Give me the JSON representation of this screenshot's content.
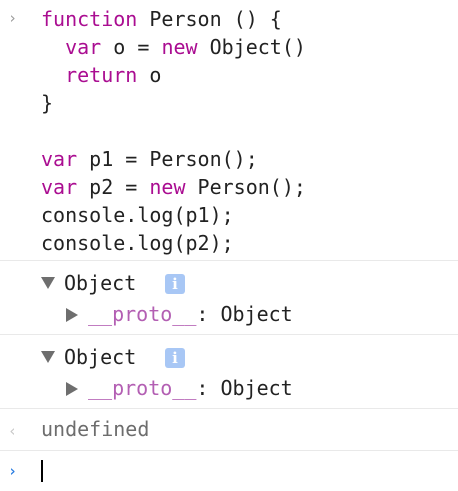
{
  "input": {
    "prompt": "›",
    "lines": [
      [
        {
          "t": "function",
          "k": true
        },
        {
          "t": " Person () {",
          "k": false
        }
      ],
      [
        {
          "t": "  ",
          "k": false
        },
        {
          "t": "var",
          "k": true
        },
        {
          "t": " o = ",
          "k": false
        },
        {
          "t": "new",
          "k": true
        },
        {
          "t": " Object()",
          "k": false
        }
      ],
      [
        {
          "t": "  ",
          "k": false
        },
        {
          "t": "return",
          "k": true
        },
        {
          "t": " o",
          "k": false
        }
      ],
      [
        {
          "t": "}",
          "k": false
        }
      ],
      [
        {
          "t": "",
          "k": false
        }
      ],
      [
        {
          "t": "var",
          "k": true
        },
        {
          "t": " p1 = Person();",
          "k": false
        }
      ],
      [
        {
          "t": "var",
          "k": true
        },
        {
          "t": " p2 = ",
          "k": false
        },
        {
          "t": "new",
          "k": true
        },
        {
          "t": " Person();",
          "k": false
        }
      ],
      [
        {
          "t": "console.log(p1);",
          "k": false
        }
      ],
      [
        {
          "t": "console.log(p2);",
          "k": false
        }
      ]
    ]
  },
  "outputs": [
    {
      "label": "Object",
      "info": "i",
      "proto_key": "__proto__",
      "proto_sep": ": ",
      "proto_value": "Object"
    },
    {
      "label": "Object",
      "info": "i",
      "proto_key": "__proto__",
      "proto_sep": ": ",
      "proto_value": "Object"
    }
  ],
  "result": {
    "arrow": "‹",
    "text": "undefined"
  },
  "prompt_input": {
    "arrow": "›",
    "value": ""
  },
  "colors": {
    "keyword": "#aa0d91",
    "proto_key": "#b35fb3",
    "info_badge": "#a8c7f5",
    "prompt_active": "#2b7de1"
  }
}
